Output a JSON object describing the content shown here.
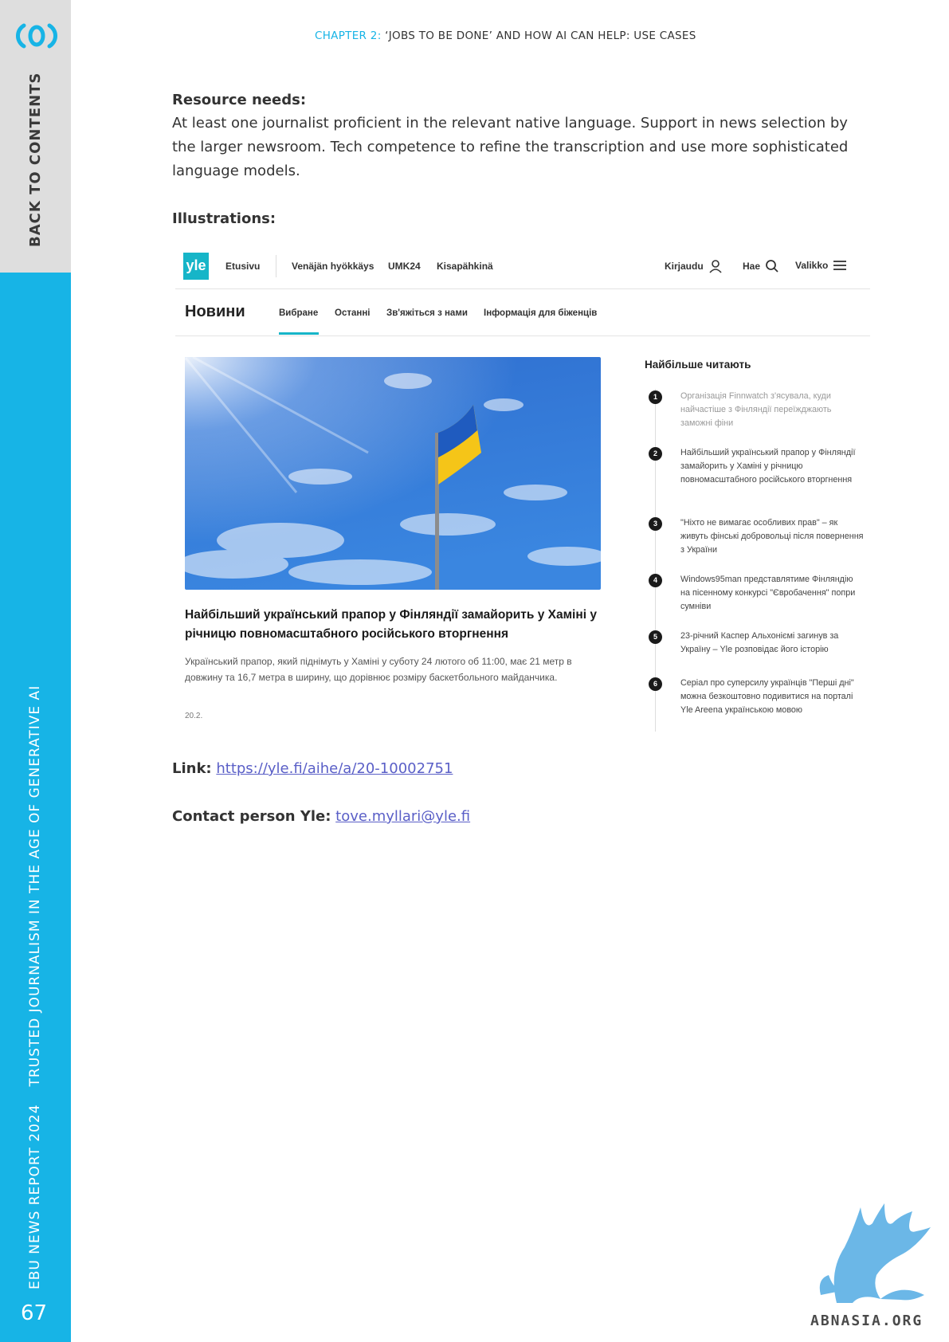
{
  "sidebar": {
    "back_to_contents": "BACK TO CONTENTS",
    "report_part1": "EBU NEWS REPORT 2024",
    "report_part2": "TRUSTED JOURNALISM IN THE AGE OF GENERATIVE AI",
    "page_number": "67",
    "colors": {
      "top": "#dedede",
      "bottom": "#17b4e6"
    },
    "logo_icon": "ebu-logo-icon"
  },
  "header": {
    "chapter_label": "CHAPTER 2:",
    "chapter_title": "‘JOBS TO BE DONE’ AND HOW AI CAN HELP: USE CASES"
  },
  "body": {
    "resource_heading": "Resource needs:",
    "resource_text": "At least one journalist proficient in the relevant native language. Support in news selection by the larger newsroom. Tech competence to refine the transcription and use more sophisticated language models.",
    "illustrations_heading": "Illustrations:",
    "link_label": "Link:",
    "link_url": "https://yle.fi/aihe/a/20-10002751",
    "contact_label": "Contact person Yle:",
    "contact_email": "tove.myllari@yle.fi"
  },
  "screenshot": {
    "logo": "yle",
    "top_nav": [
      "Etusivu",
      "Venäjän hyökkäys",
      "UMK24",
      "Kisapähkinä"
    ],
    "login": "Kirjaudu",
    "search": "Hae",
    "menu": "Valikko",
    "section_title": "Новини",
    "sub_nav": [
      "Вибране",
      "Останні",
      "Зв'яжіться з нами",
      "Інформація для біженців"
    ],
    "article": {
      "title": "Найбільший український прапор у Фінляндії замайорить у Хаміні у річницю повномасштабного російського вторгнення",
      "summary": "Український прапор, який піднімуть у Хаміні у суботу 24 лютого об 11:00, має 21 метр в довжину та 16,7 метра в ширину, що дорівнює розміру баскетбольного майданчика.",
      "date": "20.2."
    },
    "popular_title": "Найбільше читають",
    "popular": [
      {
        "num": "1",
        "text": "Організація Finnwatch з'ясувала, куди найчастіше з Фінляндії переїжджають заможні фіни"
      },
      {
        "num": "2",
        "text": "Найбільший український прапор у Фінляндії замайорить у Хаміні у річницю повномасштабного російського вторгнення"
      },
      {
        "num": "3",
        "text": "\"Ніхто не вимагає особливих прав\" – як живуть фінські добровольці після повернення з України"
      },
      {
        "num": "4",
        "text": "Windows95man представлятиме Фінляндію на пісенному конкурсі \"Євробачення\" попри сумніви"
      },
      {
        "num": "5",
        "text": "23-річний Каспер Альхоніємі загинув за Україну – Yle розповідає його історію"
      },
      {
        "num": "6",
        "text": "Серіал про суперсилу українців \"Перші дні\" можна безкоштовно подивитися на порталі Yle Areena українською мовою"
      }
    ]
  },
  "watermark": {
    "text": "ABNASIA.ORG",
    "icon": "griffin-watermark-icon"
  }
}
